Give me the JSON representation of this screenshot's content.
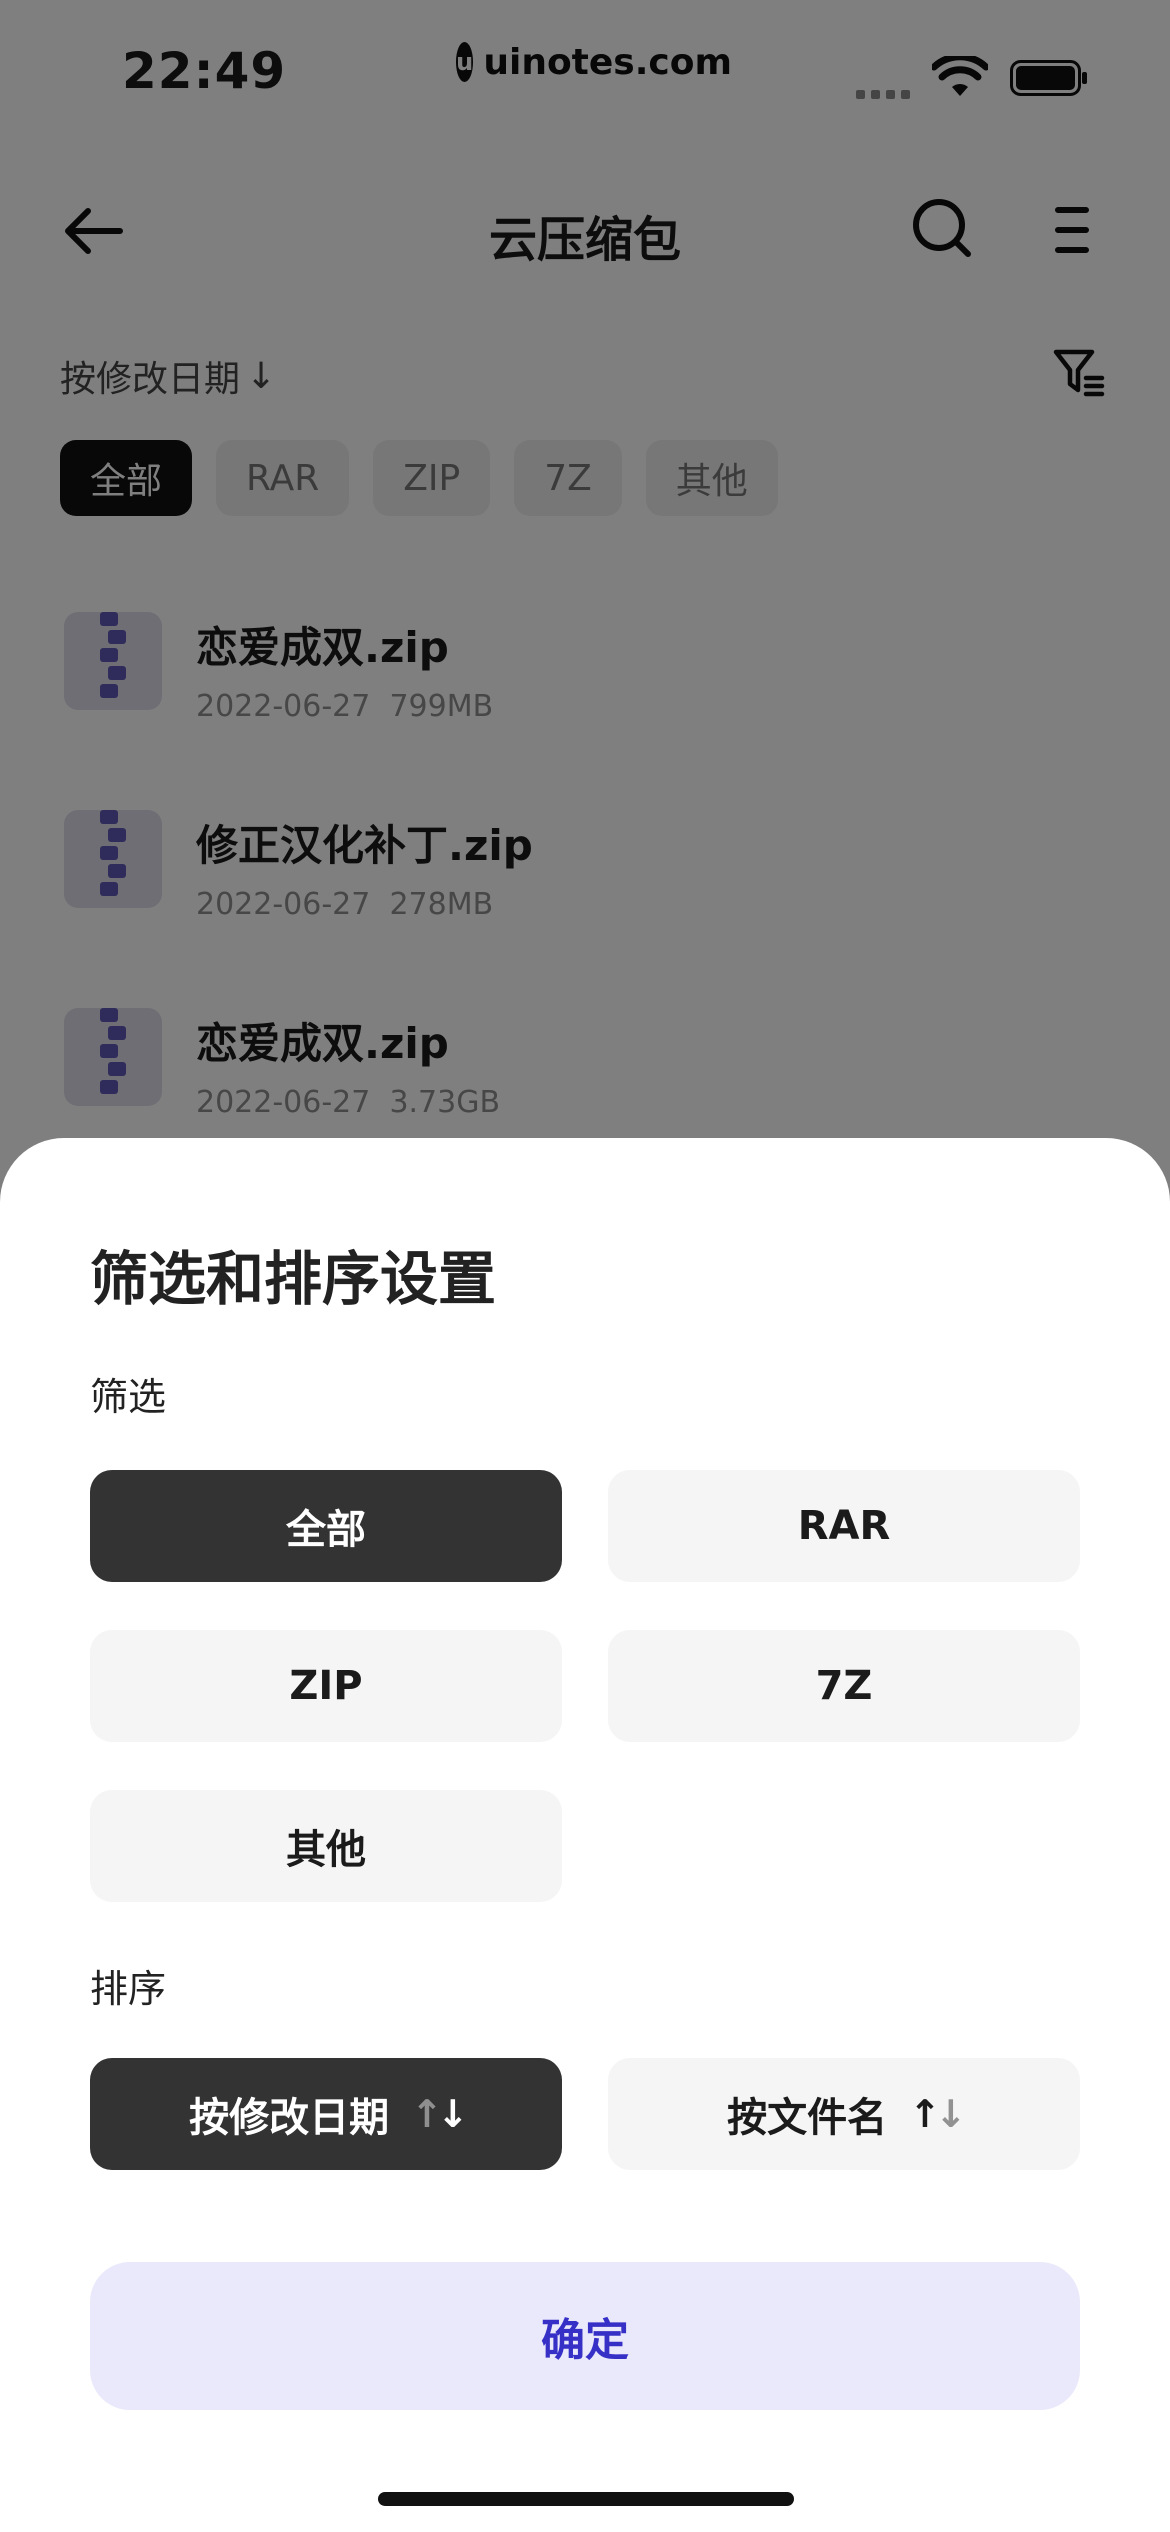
{
  "status": {
    "time": "22:49",
    "watermark": "uinotes.com",
    "watermark_logo": "u"
  },
  "header": {
    "title": "云压缩包",
    "back_icon": "arrow-left-icon",
    "search_icon": "search-icon",
    "menu_icon": "menu-icon"
  },
  "toolbar": {
    "sort_label": "按修改日期",
    "sort_arrow": "↓",
    "filter_icon": "filter-icon"
  },
  "chips": [
    {
      "label": "全部",
      "active": true
    },
    {
      "label": "RAR",
      "active": false
    },
    {
      "label": "ZIP",
      "active": false
    },
    {
      "label": "7Z",
      "active": false
    },
    {
      "label": "其他",
      "active": false
    }
  ],
  "files": [
    {
      "name": "恋爱成双.zip",
      "date": "2022-06-27",
      "size": "799MB"
    },
    {
      "name": "修正汉化补丁.zip",
      "date": "2022-06-27",
      "size": "278MB"
    },
    {
      "name": "恋爱成双.zip",
      "date": "2022-06-27",
      "size": "3.73GB"
    }
  ],
  "sheet": {
    "title": "筛选和排序设置",
    "filter_label": "筛选",
    "filter_options": [
      {
        "label": "全部",
        "active": true
      },
      {
        "label": "RAR",
        "active": false
      },
      {
        "label": "ZIP",
        "active": false
      },
      {
        "label": "7Z",
        "active": false
      },
      {
        "label": "其他",
        "active": false
      }
    ],
    "sort_label": "排序",
    "sort_options": [
      {
        "label": "按修改日期",
        "active": true
      },
      {
        "label": "按文件名",
        "active": false
      }
    ],
    "confirm_label": "确定"
  },
  "colors": {
    "accent": "#3730c7",
    "confirm_bg": "#e9e9fb",
    "active_bg": "#333333"
  }
}
